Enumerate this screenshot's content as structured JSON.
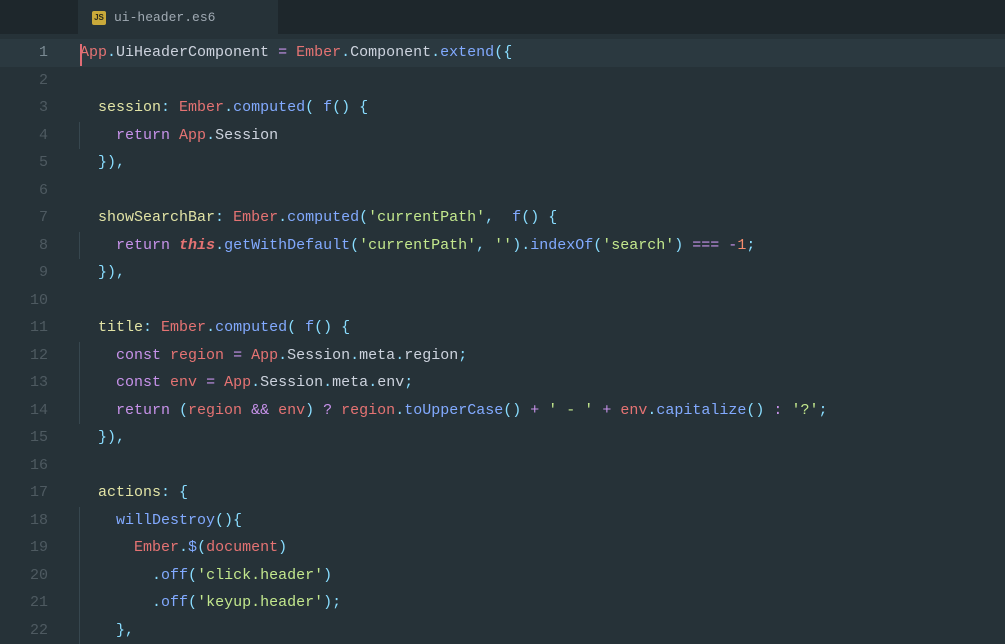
{
  "tab": {
    "icon": "JS",
    "filename": "ui-header.es6"
  },
  "lineNumbers": [
    "1",
    "2",
    "3",
    "4",
    "5",
    "6",
    "7",
    "8",
    "9",
    "10",
    "11",
    "12",
    "13",
    "14",
    "15",
    "16",
    "17",
    "18",
    "19",
    "20",
    "21",
    "22"
  ],
  "activeLine": 1,
  "code": {
    "line1": {
      "t1": "App",
      "t2": ".",
      "t3": "UiHeaderComponent",
      "t4": " ",
      "t5": "=",
      "t6": " ",
      "t7": "Ember",
      "t8": ".",
      "t9": "Component",
      "t10": ".",
      "t11": "extend",
      "t12": "({"
    },
    "line3": {
      "indent": "  ",
      "t1": "session",
      "t2": ": ",
      "t3": "Ember",
      "t4": ".",
      "t5": "computed",
      "t6": "( ",
      "t7": "f",
      "t8": "() {"
    },
    "line4": {
      "indent": "    ",
      "t1": "return",
      "t2": " ",
      "t3": "App",
      "t4": ".",
      "t5": "Session"
    },
    "line5": {
      "indent": "  ",
      "t1": "}),"
    },
    "line7": {
      "indent": "  ",
      "t1": "showSearchBar",
      "t2": ": ",
      "t3": "Ember",
      "t4": ".",
      "t5": "computed",
      "t6": "(",
      "t7": "'currentPath'",
      "t8": ",  ",
      "t9": "f",
      "t10": "() {"
    },
    "line8": {
      "indent": "    ",
      "t1": "return",
      "t2": " ",
      "t3": "this",
      "t4": ".",
      "t5": "getWithDefault",
      "t6": "(",
      "t7": "'currentPath'",
      "t8": ", ",
      "t9": "''",
      "t10": ").",
      "t11": "indexOf",
      "t12": "(",
      "t13": "'search'",
      "t14": ") ",
      "t15": "===",
      "t16": " ",
      "t17": "-",
      "t18": "1",
      "t19": ";"
    },
    "line9": {
      "indent": "  ",
      "t1": "}),"
    },
    "line11": {
      "indent": "  ",
      "t1": "title",
      "t2": ": ",
      "t3": "Ember",
      "t4": ".",
      "t5": "computed",
      "t6": "( ",
      "t7": "f",
      "t8": "() {"
    },
    "line12": {
      "indent": "    ",
      "t1": "const",
      "t2": " ",
      "t3": "region",
      "t4": " ",
      "t5": "=",
      "t6": " ",
      "t7": "App",
      "t8": ".",
      "t9": "Session",
      "t10": ".",
      "t11": "meta",
      "t12": ".",
      "t13": "region",
      "t14": ";"
    },
    "line13": {
      "indent": "    ",
      "t1": "const",
      "t2": " ",
      "t3": "env",
      "t4": " ",
      "t5": "=",
      "t6": " ",
      "t7": "App",
      "t8": ".",
      "t9": "Session",
      "t10": ".",
      "t11": "meta",
      "t12": ".",
      "t13": "env",
      "t14": ";"
    },
    "line14": {
      "indent": "    ",
      "t1": "return",
      "t2": " (",
      "t3": "region",
      "t4": " ",
      "t5": "&&",
      "t6": " ",
      "t7": "env",
      "t8": ") ",
      "t9": "?",
      "t10": " ",
      "t11": "region",
      "t12": ".",
      "t13": "toUpperCase",
      "t14": "() ",
      "t15": "+",
      "t16": " ",
      "t17": "' - '",
      "t18": " ",
      "t19": "+",
      "t20": " ",
      "t21": "env",
      "t22": ".",
      "t23": "capitalize",
      "t24": "() ",
      "t25": ":",
      "t26": " ",
      "t27": "'?'",
      "t28": ";"
    },
    "line15": {
      "indent": "  ",
      "t1": "}),"
    },
    "line17": {
      "indent": "  ",
      "t1": "actions",
      "t2": ": {"
    },
    "line18": {
      "indent": "    ",
      "t1": "willDestroy",
      "t2": "(){"
    },
    "line19": {
      "indent": "      ",
      "t1": "Ember",
      "t2": ".",
      "t3": "$",
      "t4": "(",
      "t5": "document",
      "t6": ")"
    },
    "line20": {
      "indent": "        ",
      "t1": ".",
      "t2": "off",
      "t3": "(",
      "t4": "'click.header'",
      "t5": ")"
    },
    "line21": {
      "indent": "        ",
      "t1": ".",
      "t2": "off",
      "t3": "(",
      "t4": "'keyup.header'",
      "t5": ");"
    },
    "line22": {
      "indent": "    ",
      "t1": "},"
    }
  }
}
